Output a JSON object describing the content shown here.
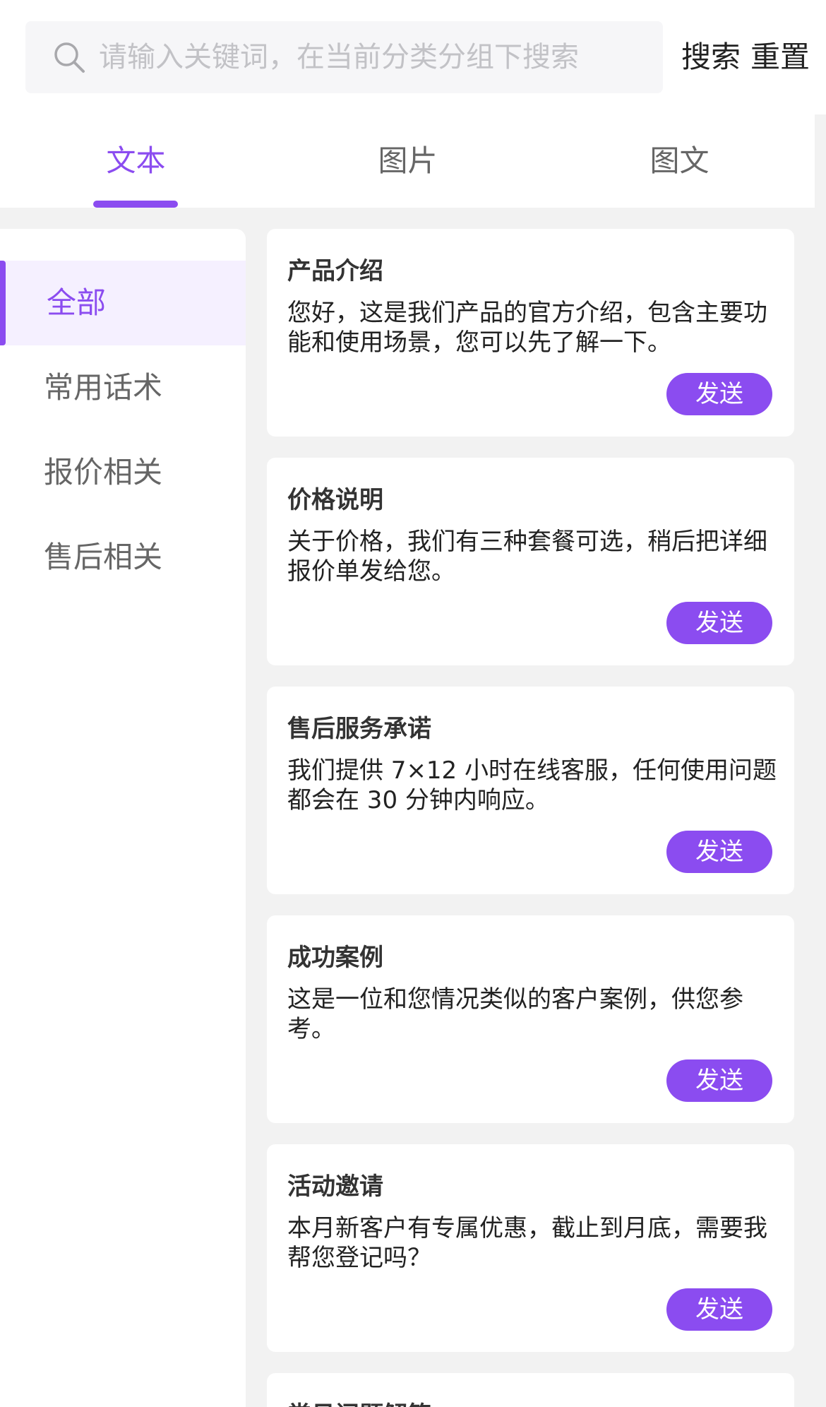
{
  "search": {
    "placeholder": "请输入关键词，在当前分类分组下搜索",
    "search_label": "搜索",
    "reset_label": "重置"
  },
  "tabs": [
    {
      "label": "文本",
      "active": true
    },
    {
      "label": "图片",
      "active": false
    },
    {
      "label": "图文",
      "active": false
    }
  ],
  "sidebar": {
    "items": [
      {
        "label": "全部",
        "active": true
      },
      {
        "label": "常用话术",
        "active": false
      },
      {
        "label": "报价相关",
        "active": false
      },
      {
        "label": "售后相关",
        "active": false
      }
    ]
  },
  "cards": [
    {
      "title": "产品介绍",
      "body": "您好，这是我们产品的官方介绍，包含主要功能和使用场景，您可以先了解一下。",
      "send_label": "发送"
    },
    {
      "title": "价格说明",
      "body": "关于价格，我们有三种套餐可选，稍后把详细报价单发给您。",
      "send_label": "发送"
    },
    {
      "title": "售后服务承诺",
      "body": "我们提供 7×12 小时在线客服，任何使用问题都会在 30 分钟内响应。",
      "send_label": "发送"
    },
    {
      "title": "成功案例",
      "body": "这是一位和您情况类似的客户案例，供您参考。",
      "send_label": "发送"
    },
    {
      "title": "活动邀请",
      "body": "本月新客户有专属优惠，截止到月底，需要我帮您登记吗？",
      "send_label": "发送"
    },
    {
      "title": "常见问题解答",
      "body": "",
      "send_label": ""
    }
  ],
  "colors": {
    "accent": "#8b4cf0",
    "accent_light": "#f5f0ff",
    "page_bg": "#f2f2f2"
  }
}
